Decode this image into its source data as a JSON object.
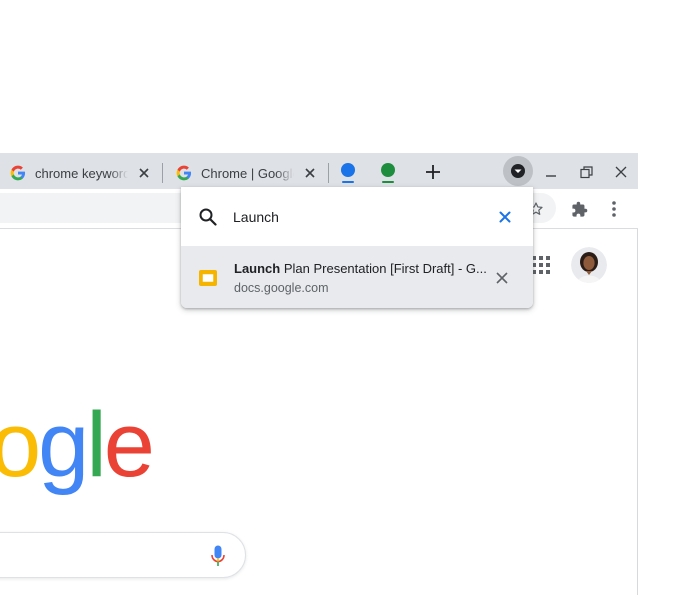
{
  "tabs": [
    {
      "title": "chrome keywords",
      "favicon": "google-g-icon",
      "close_label": "close-icon"
    },
    {
      "title": "Chrome | Google",
      "favicon": "google-g-icon",
      "close_label": "close-icon"
    }
  ],
  "tab_groups": [
    {
      "color": "#1a73e8"
    },
    {
      "color": "#1e8e3e"
    }
  ],
  "new_tab_label": "+",
  "tab_search": {
    "query": "Launch",
    "result": {
      "title_match": "Launch",
      "title_rest": " Plan Presentation [First Draft] - Google Slides",
      "url": "docs.google.com",
      "icon": "google-slides-icon",
      "icon_color": "#f4b400"
    }
  },
  "page": {
    "logo_text": "ogle",
    "logo_colors": [
      "#fbbc05",
      "#4285f4",
      "#34a853",
      "#ea4335"
    ]
  },
  "colors": {
    "tabstrip": "#dee1e6",
    "accent_blue": "#1a73e8"
  }
}
